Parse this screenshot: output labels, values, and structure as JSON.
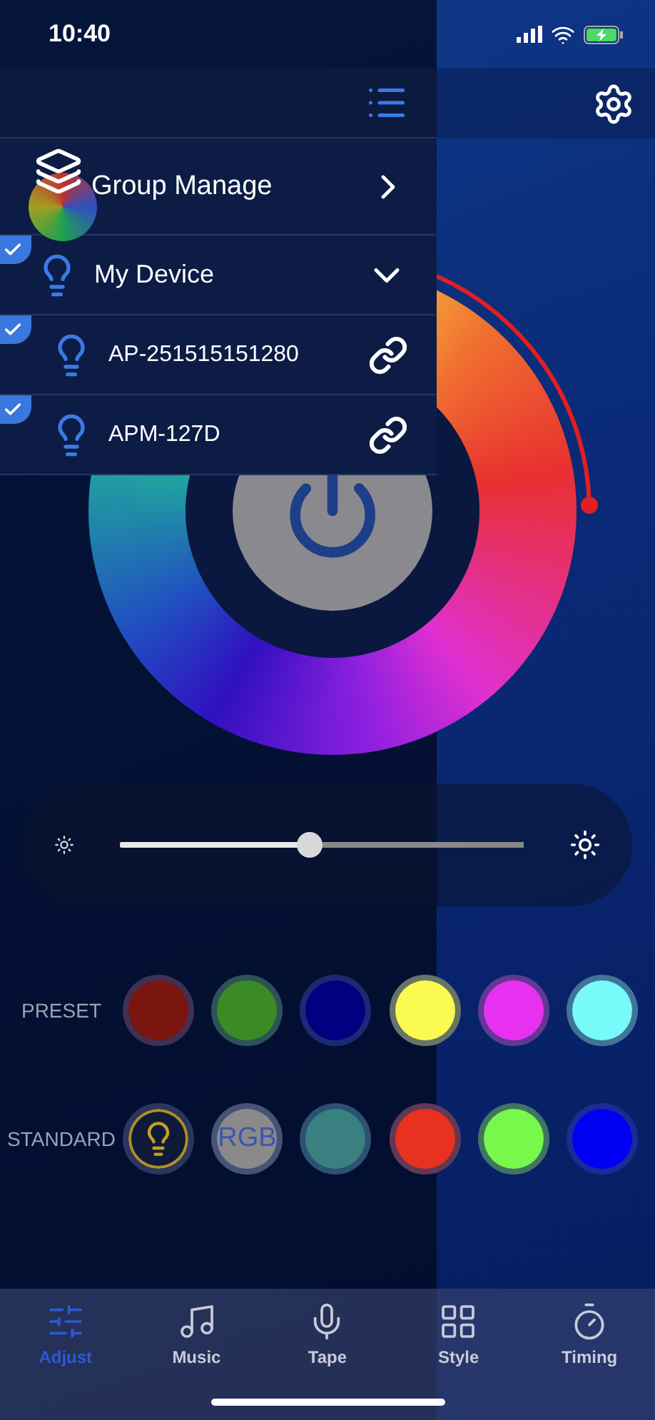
{
  "status_bar": {
    "time": "10:40"
  },
  "drawer": {
    "group_manage": {
      "label": "Group Manage"
    },
    "device_group": {
      "label": "My Device",
      "checked": true,
      "expanded": true
    },
    "devices": [
      {
        "name": "AP-251515151280",
        "checked": true
      },
      {
        "name": "APM-127D",
        "checked": true
      }
    ]
  },
  "brightness": {
    "level": 0.47
  },
  "preset": {
    "label": "PRESET",
    "swatches": [
      {
        "color": "#7a1510"
      },
      {
        "color": "#3a8a25"
      },
      {
        "color": "#000080"
      },
      {
        "color": "#fafa50"
      },
      {
        "color": "#e830f0"
      },
      {
        "color": "#78fafa"
      }
    ]
  },
  "standard": {
    "label": "STANDARD",
    "items": [
      {
        "kind": "bulb"
      },
      {
        "kind": "rgb",
        "text": "RGB"
      },
      {
        "kind": "color",
        "color": "#3a8080"
      },
      {
        "kind": "color",
        "color": "#e8321f"
      },
      {
        "kind": "color",
        "color": "#78f84a"
      },
      {
        "kind": "color",
        "color": "#0000f5"
      }
    ]
  },
  "tabs": [
    {
      "label": "Adjust",
      "selected": true
    },
    {
      "label": "Music",
      "selected": false
    },
    {
      "label": "Tape",
      "selected": false
    },
    {
      "label": "Style",
      "selected": false
    },
    {
      "label": "Timing",
      "selected": false
    }
  ]
}
